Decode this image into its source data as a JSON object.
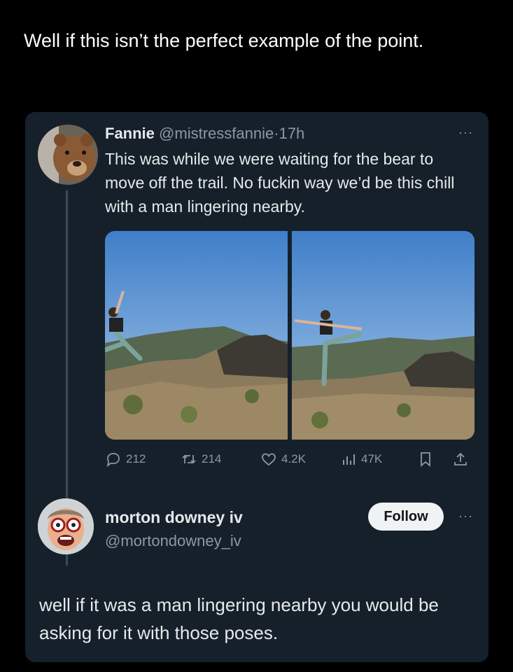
{
  "caption": "Well if this isn’t the perfect example of the point.",
  "tweet": {
    "name": "Fannie",
    "handle": "@mistressfannie",
    "separator": "·",
    "time": "17h",
    "more": "···",
    "text": "This was while we were waiting for the bear to move off the trail. No fuckin way we’d be this chill with a man lingering nearby.",
    "stats": {
      "replies": "212",
      "retweets": "214",
      "likes": "4.2K",
      "views": "47K"
    },
    "icons": [
      "reply-icon",
      "retweet-icon",
      "like-icon",
      "views-icon",
      "bookmark-icon",
      "share-icon"
    ]
  },
  "reply": {
    "name": "morton downey iv",
    "handle": "@mortondowney_iv",
    "follow_label": "Follow",
    "more": "···",
    "text": "well if it was a man lingering nearby you would be asking for it with those poses."
  },
  "colors": {
    "background": "#000000",
    "card": "#15202b",
    "text": "#e7e9ea",
    "muted": "#8b98a5",
    "follow_bg": "#eff3f4"
  }
}
